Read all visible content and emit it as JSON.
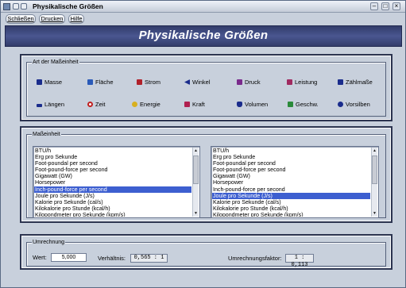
{
  "window": {
    "title": "Physikalische Größen"
  },
  "menu": [
    {
      "label": "Schließen"
    },
    {
      "label": "Drucken"
    },
    {
      "label": "Hilfe"
    }
  ],
  "header": {
    "title": "Physikalische Größen"
  },
  "art_group": {
    "legend": "Art der Maßeinheit",
    "units": [
      {
        "label": "Masse",
        "icon": "weight-icon",
        "color": "#1a2c8c"
      },
      {
        "label": "Fläche",
        "icon": "area-icon",
        "color": "#2a5ab8"
      },
      {
        "label": "Strom",
        "icon": "current-icon",
        "color": "#b0202a"
      },
      {
        "label": "Winkel",
        "icon": "angle-icon",
        "color": "#1a2c8c"
      },
      {
        "label": "Druck",
        "icon": "pressure-icon",
        "color": "#7a2a8c"
      },
      {
        "label": "Leistung",
        "icon": "power-icon",
        "color": "#a02a60"
      },
      {
        "label": "Zählmaße",
        "icon": "counting-icon",
        "color": "#1a2c8c"
      },
      {
        "label": "Längen",
        "icon": "ruler-icon",
        "color": "#1a2c8c"
      },
      {
        "label": "Zeit",
        "icon": "clock-icon",
        "color": "#c02020"
      },
      {
        "label": "Energie",
        "icon": "bulb-icon",
        "color": "#d8b020"
      },
      {
        "label": "Kraft",
        "icon": "force-icon",
        "color": "#b02050"
      },
      {
        "label": "Volumen",
        "icon": "volume-icon",
        "color": "#1a2c8c"
      },
      {
        "label": "Geschw.",
        "icon": "speed-icon",
        "color": "#2a8a3a"
      },
      {
        "label": "Vorsilben",
        "icon": "prefix-icon",
        "color": "#1a2c8c"
      }
    ]
  },
  "unit_group": {
    "legend": "Maßeinheit",
    "left_list": {
      "items": [
        "BTU/h",
        "Erg pro Sekunde",
        "Foot-poundal per second",
        "Foot-pound-force per second",
        "Gigawatt (GW)",
        "Horsepower",
        "Inch-pound-force per second",
        "Joule pro Sekunde (J/s)",
        "Kalorie pro Sekunde (cal/s)",
        "Kilokalorie pro Stunde (kcal/h)",
        "Kilopondmeter pro Sekunde (kpm/s)"
      ],
      "selected_index": 6
    },
    "right_list": {
      "items": [
        "BTU/h",
        "Erg pro Sekunde",
        "Foot-poundal per second",
        "Foot-pound-force per second",
        "Gigawatt (GW)",
        "Horsepower",
        "Inch-pound-force per second",
        "Joule pro Sekunde (J/s)",
        "Kalorie pro Sekunde (cal/s)",
        "Kilokalorie pro Stunde (kcal/h)",
        "Kilopondmeter pro Sekunde (kpm/s)"
      ],
      "selected_index": 7
    },
    "arrow": "➔"
  },
  "calc_group": {
    "legend": "Umrechnung",
    "wert_label": "Wert:",
    "wert_value": "5,000",
    "verhaeltnis_label": "Verhältnis:",
    "verhaeltnis_value": "0,565 : 1",
    "faktor_label": "Umrechnungsfaktor:",
    "faktor_value": "1 : 0,113"
  },
  "colors": {
    "header_bg": "#3a4478",
    "selection": "#3d5fd0",
    "panel_bg": "#c8d0dc"
  }
}
